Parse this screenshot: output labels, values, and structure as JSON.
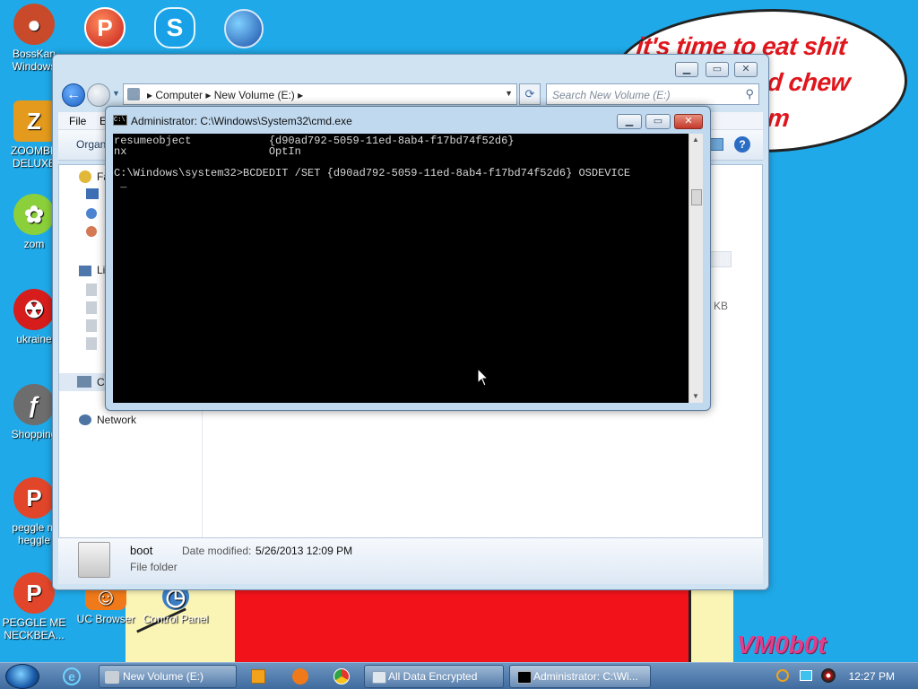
{
  "wallpaper": {
    "bubble_lines": [
      "it's time to eat shit",
      "d chew",
      "m"
    ],
    "watermark": "VM0b0t"
  },
  "desktop_icons": [
    {
      "label": "BossKan\nWindows",
      "icon": "bosskan-icon",
      "color": "#c84a2a"
    },
    {
      "label": "ZOOMBE\nDELUXE",
      "icon": "zoombe-icon",
      "color": "#e49a1c"
    },
    {
      "label": "zom",
      "icon": "zombie-flower-icon",
      "color": "#8bcf3a"
    },
    {
      "label": "ukraine",
      "icon": "radiation-icon",
      "color": "#d71c1c"
    },
    {
      "label": "Shopping",
      "icon": "flash-icon",
      "color": "#6d6d6d"
    },
    {
      "label": "peggle m\nheggle",
      "icon": "peggle-icon",
      "color": "#e2462a"
    },
    {
      "label": "PEGGLE ME\nNECKBEA...",
      "icon": "peggle-icon",
      "color": "#e2462a"
    },
    {
      "label": "UC Browser",
      "icon": "uc-browser-icon",
      "color": "#f07a1a"
    },
    {
      "label": "Control Panel",
      "icon": "control-panel-icon",
      "color": "#3a7ec8"
    }
  ],
  "explorer": {
    "breadcrumb": [
      "Computer",
      "New Volume (E:)"
    ],
    "search_placeholder": "Search New Volume (E:)",
    "menu": [
      "File",
      "E"
    ],
    "organize_label": "Organ",
    "nav_items": [
      "Fa",
      "Li",
      "C",
      "Network"
    ],
    "size_unit": "KB",
    "details": {
      "name": "boot",
      "date_label": "Date modified:",
      "date_value": "5/26/2013 12:09 PM",
      "type": "File folder"
    }
  },
  "cmd": {
    "title": "Administrator: C:\\Windows\\System32\\cmd.exe",
    "lines": [
      "resumeobject            {d90ad792-5059-11ed-8ab4-f17bd74f52d6}",
      "nx                      OptIn",
      "",
      "C:\\Windows\\system32>BCDEDIT /SET {d90ad792-5059-11ed-8ab4-f17bd74f52d6} OSDEVICE",
      " _"
    ]
  },
  "taskbar": {
    "buttons": [
      {
        "label": "New Volume (E:)",
        "icon": "folder-icon"
      },
      {
        "label": "All Data Encrypted",
        "icon": "window-icon"
      },
      {
        "label": "Administrator: C:\\Wi...",
        "icon": "cmd-icon"
      }
    ],
    "clock": "12:27 PM"
  }
}
